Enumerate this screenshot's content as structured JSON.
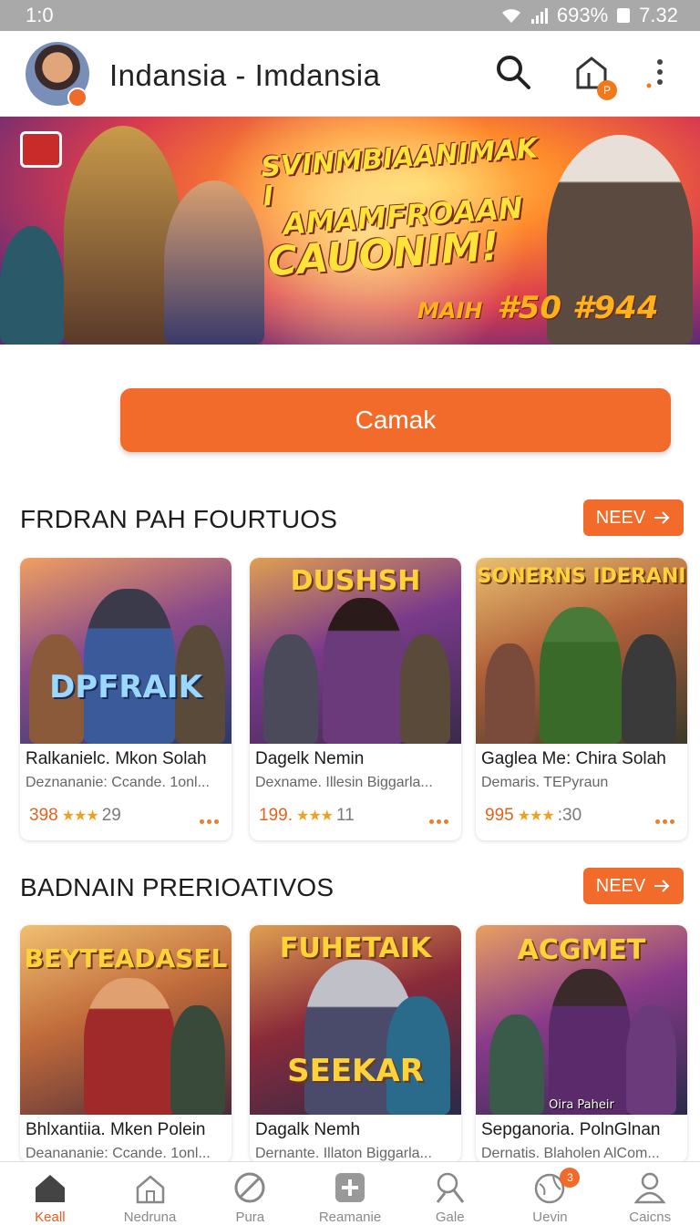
{
  "status_bar": {
    "left": "1:0",
    "battery": "693%",
    "time": "7.32"
  },
  "header": {
    "title": "Indansia - Imdansia",
    "cart_count": "P"
  },
  "hero": {
    "line1": "SVINMBIAANIMAK I",
    "line2": "AMAMFROAAN",
    "line3": "CAUONIM!",
    "price_label": "MAIH",
    "price_values": "#50 #944"
  },
  "cta": {
    "label": "Camak"
  },
  "sections": [
    {
      "title": "FRDRAN PAH FOURTUOS",
      "button": "NEEV",
      "cards": [
        {
          "title": "Ralkanielc. Mkon Solah",
          "subtitle": "Deznananie: Ccande. 1onl...",
          "price": "398",
          "rating": "★★★",
          "count": "29",
          "art_text": "DPFRAIK"
        },
        {
          "title": "Dagelk Nemin",
          "subtitle": "Dexname. Illesin Biggarla...",
          "price": "199.",
          "rating": "★★★",
          "count": "11",
          "art_text": "DUSHSH"
        },
        {
          "title": "Gaglea Me: Chira Solah",
          "subtitle": "Demaris. TEPyraun",
          "price": "995",
          "rating": "★★★",
          "count": ":30",
          "art_text": "SONERNS IDERANI"
        }
      ]
    },
    {
      "title": "BADNAIN PRERIOATIVOS",
      "button": "NEEV",
      "cards": [
        {
          "title": "Bhlxantiia. Mken Polein",
          "subtitle": "Deanananie: Ccande. 1onl...",
          "art_text": "BEYTEADASEL"
        },
        {
          "title": "Dagalk Nemh",
          "subtitle": "Dernante. Illaton Biggarla...",
          "art_text": "FUHETAIK",
          "art_text_2": "SEEKAR"
        },
        {
          "title": "Sepganoria. PolnGlnan",
          "subtitle": "Dernatis. Blaholen AlCom...",
          "art_text": "ACGMET",
          "art_text_2": "Oira Paheir"
        }
      ]
    }
  ],
  "bottom_nav": [
    {
      "label": "Keall",
      "icon": "home-icon",
      "active": true
    },
    {
      "label": "Nedruna",
      "icon": "house-outline-icon"
    },
    {
      "label": "Pura",
      "icon": "slash-circle-icon"
    },
    {
      "label": "Reamanie",
      "icon": "plus-box-icon"
    },
    {
      "label": "Gale",
      "icon": "person-search-icon"
    },
    {
      "label": "Uevin",
      "icon": "globe-icon",
      "badge": "3"
    },
    {
      "label": "Caicns",
      "icon": "profile-icon"
    }
  ],
  "colors": {
    "accent": "#f26b2a",
    "status_bar": "#a9a9a9",
    "stars": "#f0a020"
  }
}
